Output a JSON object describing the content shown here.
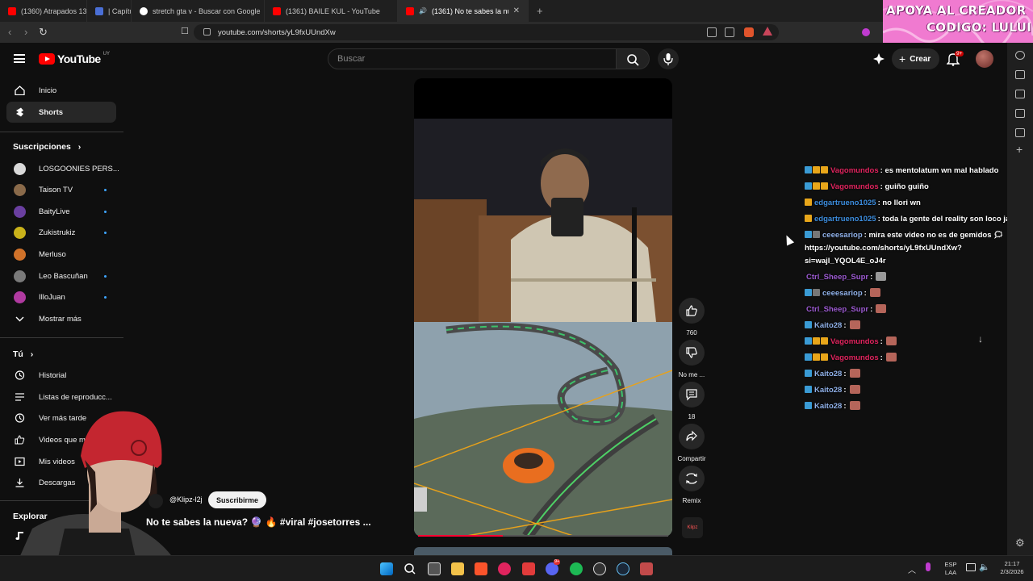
{
  "browser": {
    "tabs": [
      {
        "title": "(1360) Atrapados 133",
        "color": "#ff0000"
      },
      {
        "title": "| Capítul",
        "color": "#4a6fd6"
      },
      {
        "title": "stretch gta v - Buscar con Google",
        "color": "#4285f4"
      },
      {
        "title": "(1361) BAILE KUL - YouTube",
        "color": "#ff0000"
      },
      {
        "title": "(1361) No te sabes la nueva?",
        "color": "#ff0000"
      }
    ],
    "new_tab": "+",
    "url": "youtube.com/shorts/yL9fxUUndXw"
  },
  "promo": {
    "line1": "APOYA AL CREADOR",
    "line2": "CODIGO: LULUI"
  },
  "header": {
    "logo": "YouTube",
    "country": "UY",
    "search_placeholder": "Buscar",
    "create_label": "Crear",
    "notif_badge": "9+"
  },
  "sidebar": {
    "main": [
      {
        "label": "Inicio",
        "icon": "home-icon"
      },
      {
        "label": "Shorts",
        "icon": "shorts-icon",
        "selected": true
      }
    ],
    "subs_heading": "Suscripciones",
    "subs": [
      {
        "label": "LOSGOONIES PERS...",
        "color": "#d9d9d9",
        "dot": false
      },
      {
        "label": "Taison TV",
        "color": "#8a6a4a",
        "dot": true
      },
      {
        "label": "BaityLive",
        "color": "#6a3fa0",
        "dot": true
      },
      {
        "label": "Zukistrukiz",
        "color": "#c9b21a",
        "dot": true
      },
      {
        "label": "Merluso",
        "color": "#d0722a",
        "dot": false
      },
      {
        "label": "Leo Bascuñan",
        "color": "#7a7a7a",
        "dot": true
      },
      {
        "label": "IlloJuan",
        "color": "#b03aa0",
        "dot": true
      }
    ],
    "show_more": "Mostrar más",
    "you_heading": "Tú",
    "you": [
      {
        "label": "Historial",
        "icon": "history-icon"
      },
      {
        "label": "Listas de reproducc...",
        "icon": "playlists-icon"
      },
      {
        "label": "Ver más tarde",
        "icon": "clock-icon"
      },
      {
        "label": "Videos que me",
        "icon": "like-icon"
      },
      {
        "label": "Mis videos",
        "icon": "my-videos-icon"
      },
      {
        "label": "Descargas",
        "icon": "download-icon"
      }
    ],
    "explore_heading": "Explorar"
  },
  "short": {
    "channel": "@Klipz-l2j",
    "subscribe": "Suscribirme",
    "title": "No te sabes la nueva? 🔮 🔥 #viral #josetorres ...",
    "progress": 0.34,
    "actions": {
      "likes": "760",
      "dislike": "No me ...",
      "comments": "18",
      "share": "Compartir",
      "remix": "Remix"
    },
    "channel_thumb": "Klipz"
  },
  "chat": [
    {
      "user": "Vagomundos",
      "color": "#e0245e",
      "badges": [
        "#3a9bd5",
        "#e8a61a",
        "#e8a61a"
      ],
      "text": ": es mentolatum wn mal hablado"
    },
    {
      "user": "Vagomundos",
      "color": "#e0245e",
      "badges": [
        "#3a9bd5",
        "#e8a61a",
        "#e8a61a"
      ],
      "text": ": guiño guiño"
    },
    {
      "user": "edgartrueno1025",
      "color": "#3c8dde",
      "badges": [
        "#e8a61a"
      ],
      "text": ": no llori wn"
    },
    {
      "user": "edgartrueno1025",
      "color": "#3c8dde",
      "badges": [
        "#e8a61a"
      ],
      "text": ": toda la gente del reality son loco jajaj"
    },
    {
      "user": "ceeesariop",
      "color": "#8fb0e8",
      "badges": [
        "#3a9bd5",
        "#777777"
      ],
      "text": ": mira este video no es de gemidos 🗯 https://youtube.com/shorts/yL9fxUUndXw?si=wajl_YQOL4E_oJ4r"
    },
    {
      "user": "Ctrl_Sheep_Supr",
      "color": "#9b59d0",
      "badges": [],
      "text": ":",
      "emote": "gray"
    },
    {
      "user": "ceeesariop",
      "color": "#8fb0e8",
      "badges": [
        "#3a9bd5",
        "#777777"
      ],
      "text": ":",
      "emote": "red"
    },
    {
      "user": "Ctrl_Sheep_Supr",
      "color": "#9b59d0",
      "badges": [],
      "text": ":",
      "emote": "red"
    },
    {
      "user": "Kaito28",
      "color": "#8fb0e8",
      "badges": [
        "#3a9bd5"
      ],
      "text": ":",
      "emote": "red"
    },
    {
      "user": "Vagomundos",
      "color": "#e0245e",
      "badges": [
        "#3a9bd5",
        "#e8a61a",
        "#e8a61a"
      ],
      "text": ":",
      "emote": "red"
    },
    {
      "user": "Vagomundos",
      "color": "#e0245e",
      "badges": [
        "#3a9bd5",
        "#e8a61a",
        "#e8a61a"
      ],
      "text": ":",
      "emote": "red"
    },
    {
      "user": "Kaito28",
      "color": "#8fb0e8",
      "badges": [
        "#3a9bd5"
      ],
      "text": ":",
      "emote": "red"
    },
    {
      "user": "Kaito28",
      "color": "#8fb0e8",
      "badges": [
        "#3a9bd5"
      ],
      "text": ":",
      "emote": "red"
    },
    {
      "user": "Kaito28",
      "color": "#8fb0e8",
      "badges": [
        "#3a9bd5"
      ],
      "text": ":",
      "emote": "red"
    }
  ],
  "taskbar": {
    "lang": "ESP",
    "lang2": "LAA",
    "time": "21:17",
    "date": "2/3/2026",
    "discord_badge": "9+"
  }
}
